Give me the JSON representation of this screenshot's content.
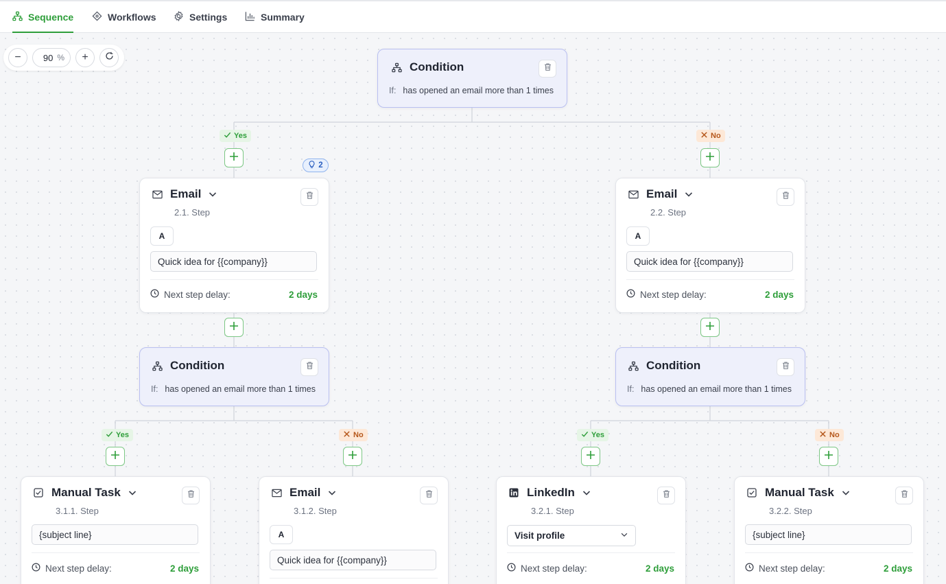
{
  "tabs": [
    {
      "label": "Sequence",
      "icon": "sequence-icon",
      "active": true
    },
    {
      "label": "Workflows",
      "icon": "workflows-icon",
      "active": false
    },
    {
      "label": "Settings",
      "icon": "gear-icon",
      "active": false
    },
    {
      "label": "Summary",
      "icon": "bar-chart-icon",
      "active": false
    }
  ],
  "zoom": {
    "value": "90",
    "unit": "%",
    "minus": "−",
    "plus": "+"
  },
  "branch_labels": {
    "yes": "Yes",
    "no": "No"
  },
  "hint_count": "2",
  "colors": {
    "accent": "#2e9e3a",
    "condition_bg": "#eef0fb",
    "no_badge": "#b5561a"
  },
  "condition_top": {
    "title": "Condition",
    "if_label": "If:",
    "text": "has opened an email more than 1 times"
  },
  "email_left": {
    "title": "Email",
    "step": "2.1. Step",
    "variant": "A",
    "subject": "Quick idea for {{company}}",
    "delay_label": "Next step delay:",
    "delay_value": "2 days"
  },
  "email_right": {
    "title": "Email",
    "step": "2.2. Step",
    "variant": "A",
    "subject": "Quick idea for {{company}}",
    "delay_label": "Next step delay:",
    "delay_value": "2 days"
  },
  "condition_left": {
    "title": "Condition",
    "if_label": "If:",
    "text": "has opened an email more than 1 times"
  },
  "condition_right": {
    "title": "Condition",
    "if_label": "If:",
    "text": "has opened an email more than 1 times"
  },
  "task_311": {
    "title": "Manual Task",
    "step": "3.1.1. Step",
    "subject": "{subject line}",
    "delay_label": "Next step delay:",
    "delay_value": "2 days"
  },
  "email_312": {
    "title": "Email",
    "step": "3.1.2. Step",
    "variant": "A",
    "subject": "Quick idea for {{company}}"
  },
  "linkedin_321": {
    "title": "LinkedIn",
    "step": "3.2.1. Step",
    "action": "Visit profile",
    "delay_label": "Next step delay:",
    "delay_value": "2 days"
  },
  "task_322": {
    "title": "Manual Task",
    "step": "3.2.2. Step",
    "subject": "{subject line}",
    "delay_label": "Next step delay:",
    "delay_value": "2 days"
  }
}
